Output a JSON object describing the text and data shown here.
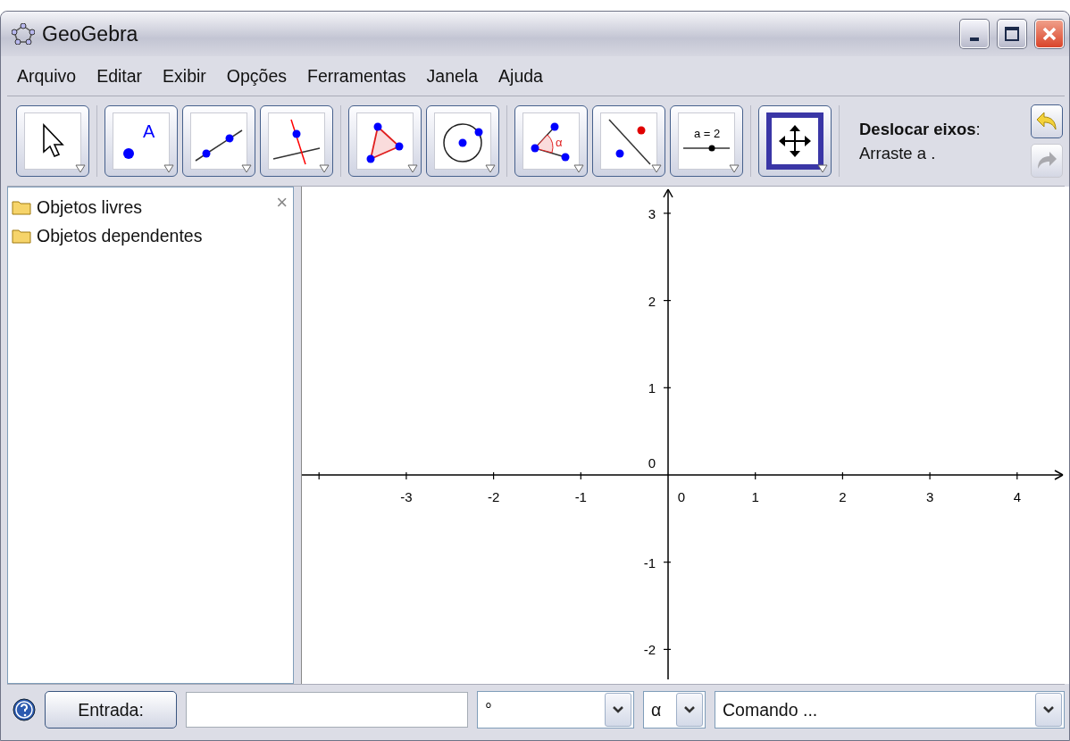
{
  "window": {
    "title": "GeoGebra",
    "controls": [
      {
        "kind": "minimize"
      },
      {
        "kind": "maximize"
      },
      {
        "kind": "close"
      }
    ]
  },
  "menu": [
    "Arquivo",
    "Editar",
    "Exibir",
    "Opções",
    "Ferramentas",
    "Janela",
    "Ajuda"
  ],
  "toolbar": {
    "groups": [
      {
        "tools": [
          {
            "kind": "move",
            "selected": false
          }
        ]
      },
      {
        "tools": [
          {
            "kind": "point",
            "label": "A",
            "selected": false
          },
          {
            "kind": "line",
            "selected": false
          },
          {
            "kind": "perpendicular",
            "selected": false
          }
        ]
      },
      {
        "tools": [
          {
            "kind": "polygon",
            "selected": false
          },
          {
            "kind": "circle",
            "selected": false
          }
        ]
      },
      {
        "tools": [
          {
            "kind": "angle",
            "label": "α",
            "selected": false
          },
          {
            "kind": "reflect",
            "selected": false
          },
          {
            "kind": "slider",
            "label": "a = 2",
            "selected": false
          }
        ]
      },
      {
        "tools": [
          {
            "kind": "move-graphics",
            "selected": true
          }
        ]
      }
    ],
    "help_text": "**Deslocar eixos**: Arraste a .",
    "undo": {
      "disabled": false
    },
    "redo": {
      "disabled": true
    }
  },
  "algebra": {
    "items": [
      {
        "label": "Objetos livres"
      },
      {
        "label": "Objetos dependentes"
      }
    ],
    "close": "×"
  },
  "graphics": {
    "x_labels": [
      "-3",
      "-2",
      "-1",
      "0",
      "1",
      "2",
      "3",
      "4"
    ],
    "y_labels": [
      "3",
      "2",
      "1",
      "-1",
      "-2"
    ],
    "origin_label": "0"
  },
  "input_bar": {
    "button": "Entrada:",
    "value_select": "°",
    "symbol_select": "α",
    "command_select": "Comando ..."
  }
}
